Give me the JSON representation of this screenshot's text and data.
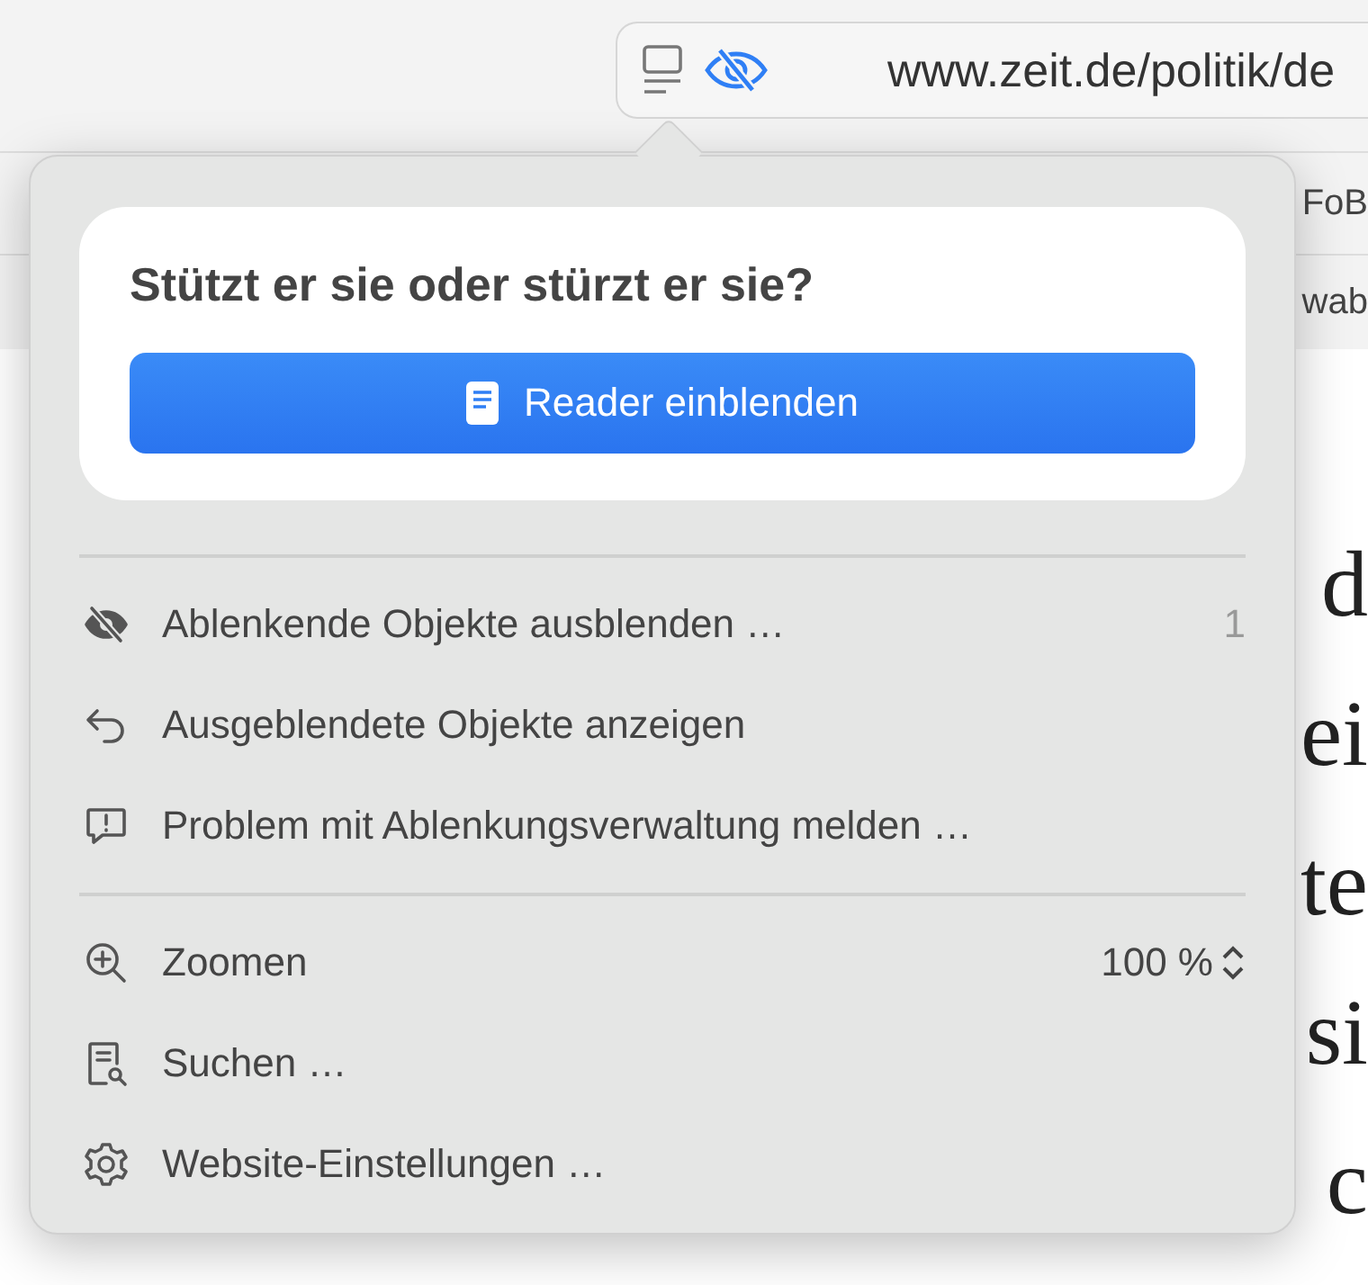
{
  "toolbar": {
    "url": "www.zeit.de/politik/de"
  },
  "bookmark_rows": [
    {
      "right": "FoB"
    },
    {
      "right": "wab"
    }
  ],
  "page_lines": [
    {
      "right": "d"
    },
    {
      "right": "ei"
    },
    {
      "right": "te"
    },
    {
      "right": "si"
    },
    {
      "right": "c"
    }
  ],
  "popover": {
    "article_title": "Stützt er sie oder stürzt er sie?",
    "reader_button": "Reader einblenden",
    "sections": [
      [
        {
          "kind": "hide",
          "label": "Ablenkende Objekte ausblenden …",
          "count": "1"
        },
        {
          "kind": "undo",
          "label": "Ausgeblendete Objekte anzeigen"
        },
        {
          "kind": "report",
          "label": "Problem mit Ablenkungsverwaltung melden …"
        }
      ],
      [
        {
          "kind": "zoom",
          "label": "Zoomen",
          "value": "100 %"
        },
        {
          "kind": "find",
          "label": "Suchen …"
        },
        {
          "kind": "settings",
          "label": "Website-Einstellungen …"
        }
      ]
    ]
  }
}
